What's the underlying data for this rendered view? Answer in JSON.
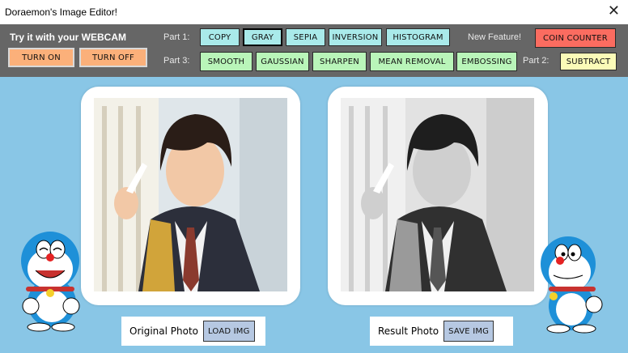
{
  "window": {
    "title": "Doraemon's Image Editor!",
    "close": "✕"
  },
  "toolbar": {
    "webcam_label": "Try it with your WEBCAM",
    "turn_on": "TURN ON",
    "turn_off": "TURN OFF",
    "part1": "Part 1:",
    "part2": "Part 2:",
    "part3": "Part 3:",
    "new_feature": "New Feature!",
    "copy": "COPY",
    "gray": "GRAY",
    "sepia": "SEPIA",
    "inversion": "INVERSION",
    "histogram": "HISTOGRAM",
    "coin_counter": "COIN COUNTER",
    "smooth": "SMOOTH",
    "gaussian": "GAUSSIAN",
    "sharpen": "SHARPEN",
    "mean_removal": "MEAN REMOVAL",
    "embossing": "EMBOSSING",
    "subtract": "SUBTRACT"
  },
  "original": {
    "label": "Original Photo",
    "button": "LOAD IMG"
  },
  "result": {
    "label": "Result Photo",
    "button": "SAVE IMG"
  },
  "colors": {
    "background": "#89c6e6",
    "toolbar": "#666666",
    "teal": "#a9eaea",
    "green": "#b9f5b9",
    "orange": "#fbb07a",
    "red": "#fb6c60",
    "yellow": "#fbfbb8"
  }
}
